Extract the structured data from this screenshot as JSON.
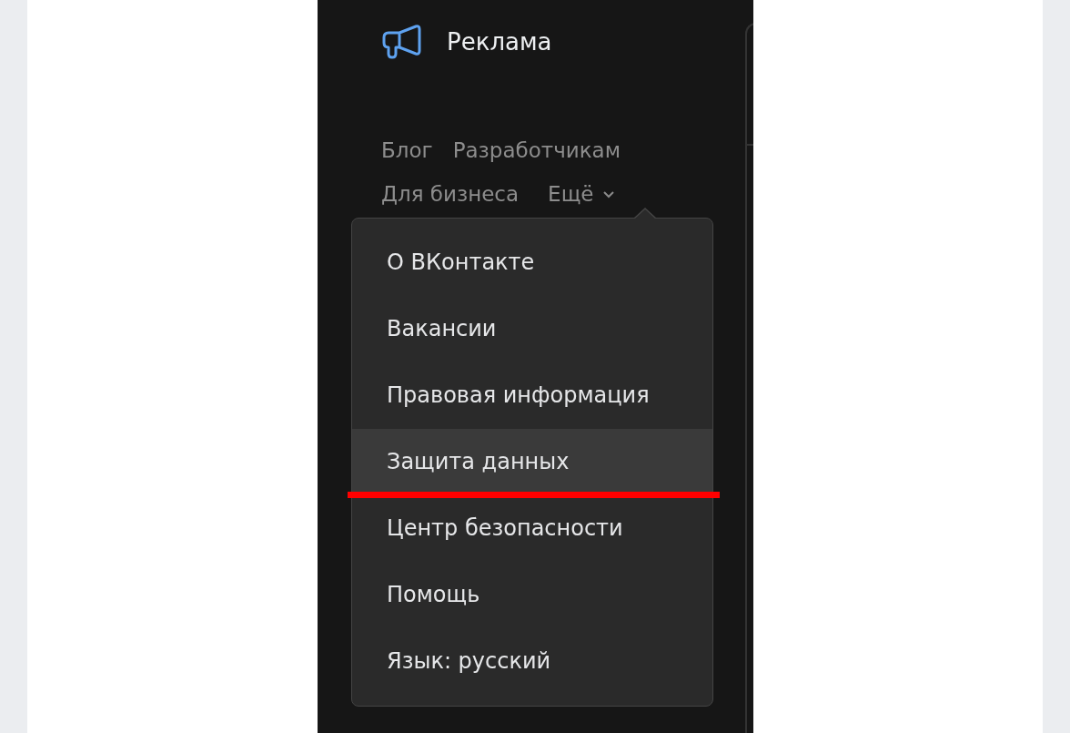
{
  "header": {
    "title": "Реклама"
  },
  "nav": [
    {
      "label": "Блог"
    },
    {
      "label": "Разработчикам"
    },
    {
      "label": "Для бизнеса"
    }
  ],
  "more": {
    "label": "Ещё",
    "expanded": true
  },
  "menu": [
    {
      "label": "О ВКонтакте",
      "selected": false,
      "underlined": false
    },
    {
      "label": "Вакансии",
      "selected": false,
      "underlined": false
    },
    {
      "label": "Правовая информация",
      "selected": false,
      "underlined": false
    },
    {
      "label": "Защита данных",
      "selected": true,
      "underlined": true
    },
    {
      "label": "Центр безопасности",
      "selected": false,
      "underlined": false
    },
    {
      "label": "Помощь",
      "selected": false,
      "underlined": false
    },
    {
      "label": "Язык: русский",
      "selected": false,
      "underlined": false
    }
  ]
}
